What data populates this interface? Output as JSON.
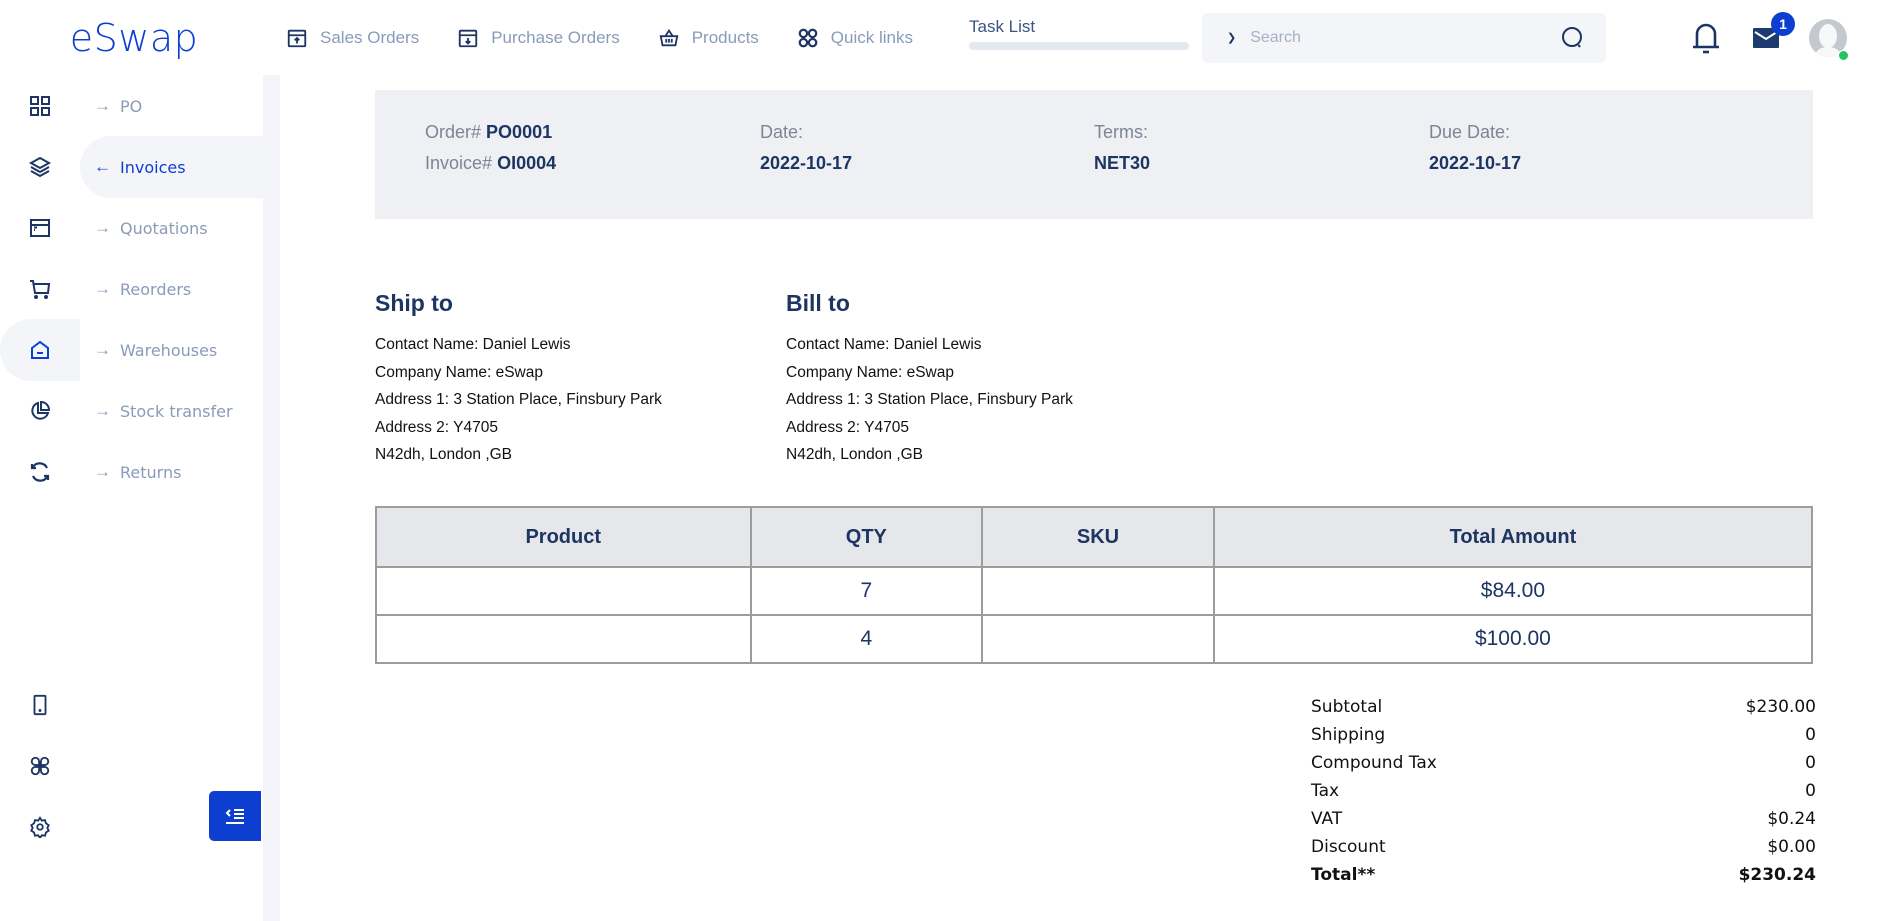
{
  "app": {
    "logo": "eSwap"
  },
  "topnav": {
    "items": [
      {
        "label": "Sales Orders",
        "icon": "archive-up-icon"
      },
      {
        "label": "Purchase Orders",
        "icon": "archive-down-icon"
      },
      {
        "label": "Products",
        "icon": "basket-icon"
      },
      {
        "label": "Quick links",
        "icon": "quick-links-icon"
      }
    ],
    "task_list": {
      "label": "Task List",
      "progress": 0
    },
    "search": {
      "placeholder": "Search",
      "value": ""
    },
    "mail_badge": "1",
    "avatar_status_color": "#22c55e"
  },
  "sidebar": {
    "items": [
      {
        "icon": "grid-icon",
        "label": "PO",
        "arrow": "→"
      },
      {
        "icon": "layers-icon",
        "label": "Invoices",
        "arrow": "←",
        "active": true
      },
      {
        "icon": "browser-window-icon",
        "label": "Quotations",
        "arrow": "→"
      },
      {
        "icon": "cart-icon",
        "label": "Reorders",
        "arrow": "→"
      },
      {
        "icon": "warehouse-icon",
        "label": "Warehouses",
        "arrow": "→",
        "icon_active": true
      },
      {
        "icon": "pie-chart-icon",
        "label": "Stock transfer",
        "arrow": "→"
      },
      {
        "icon": "refresh-icon",
        "label": "Returns",
        "arrow": "→"
      }
    ],
    "bottom_icons": [
      "tablet-icon",
      "apps-icon",
      "settings-icon"
    ]
  },
  "invoice": {
    "order_label": "Order#",
    "order_value": "PO0001",
    "invoice_label": "Invoice#",
    "invoice_value": "OI0004",
    "date_label": "Date:",
    "date_value": "2022-10-17",
    "terms_label": "Terms:",
    "terms_value": "NET30",
    "due_label": "Due Date:",
    "due_value": "2022-10-17"
  },
  "ship_to": {
    "title": "Ship to",
    "lines": [
      "Contact Name: Daniel Lewis",
      "Company Name: eSwap",
      "Address 1: 3 Station Place, Finsbury Park",
      "Address 2: Y4705",
      "N42dh, London ,GB"
    ]
  },
  "bill_to": {
    "title": "Bill to",
    "lines": [
      "Contact Name: Daniel Lewis",
      "Company Name: eSwap",
      "Address 1: 3 Station Place, Finsbury Park",
      "Address 2: Y4705",
      "N42dh, London ,GB"
    ]
  },
  "items_table": {
    "headers": [
      "Product",
      "QTY",
      "SKU",
      "Total Amount"
    ],
    "rows": [
      {
        "product": "",
        "qty": "7",
        "sku": "",
        "total": "$84.00"
      },
      {
        "product": "",
        "qty": "4",
        "sku": "",
        "total": "$100.00"
      }
    ]
  },
  "totals": [
    {
      "label": "Subtotal",
      "value": "$230.00"
    },
    {
      "label": "Shipping",
      "value": "0"
    },
    {
      "label": "Compound Tax",
      "value": "0"
    },
    {
      "label": "Tax",
      "value": "0"
    },
    {
      "label": "VAT",
      "value": "$0.24"
    },
    {
      "label": "Discount",
      "value": "$0.00"
    },
    {
      "label": "Total**",
      "value": "$230.24",
      "bold": true
    }
  ],
  "colors": {
    "brand": "#0c3fd1",
    "navy": "#1d3562",
    "muted": "#8a9bb9"
  }
}
